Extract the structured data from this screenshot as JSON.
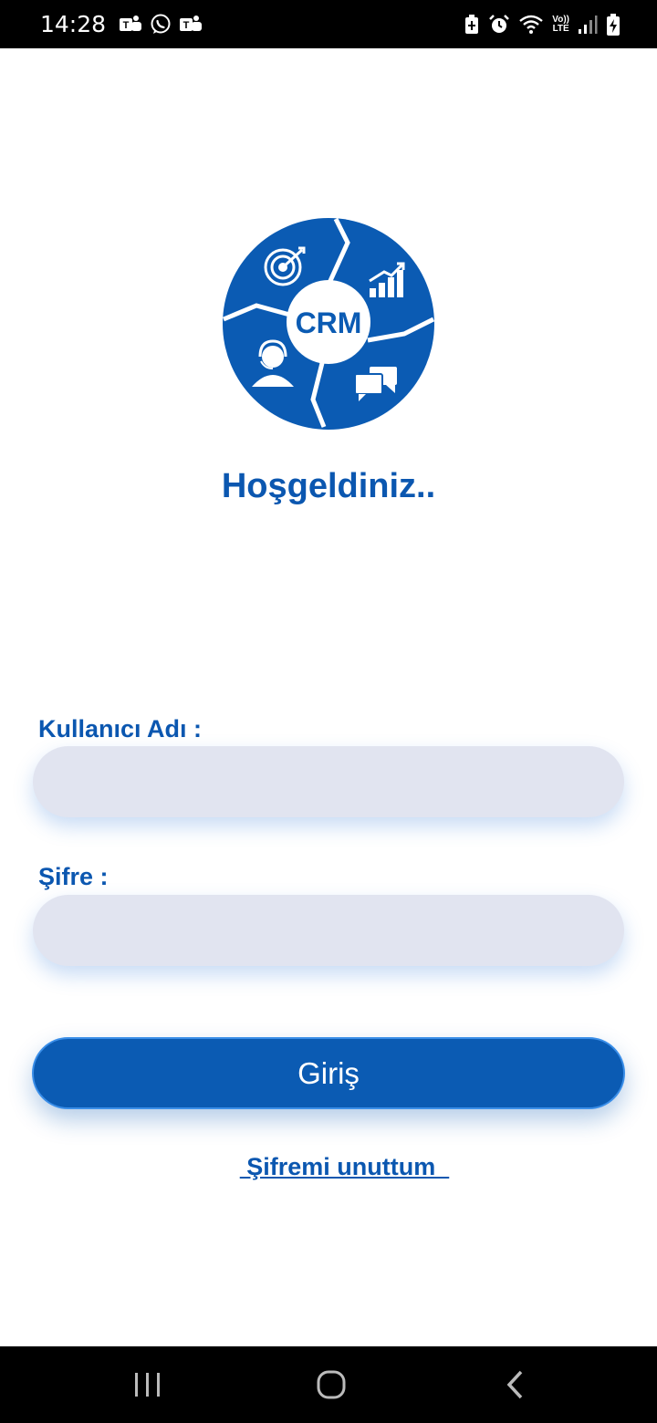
{
  "status_bar": {
    "time": "14:28",
    "left_icons": [
      "teams-icon",
      "whatsapp-icon",
      "teams-icon"
    ],
    "right_icons": [
      "battery-saver-icon",
      "alarm-icon",
      "wifi-icon",
      "volte-icon",
      "signal-icon",
      "battery-charging-icon"
    ],
    "volte_top": "Vo))",
    "volte_bottom": "LTE"
  },
  "logo": {
    "text": "CRM",
    "color": "#0b5bb3"
  },
  "welcome": "Hoşgeldiniz..",
  "form": {
    "username_label": "Kullanıcı Adı :",
    "username_value": "",
    "password_label": "Şifre :",
    "password_value": "",
    "login_label": "Giriş",
    "forgot_label": " Şifremi unuttum  "
  },
  "nav_bar": {
    "icons": [
      "recent-apps-icon",
      "home-icon",
      "back-icon"
    ]
  },
  "colors": {
    "accent": "#0b57b0",
    "button": "#0b5bb3",
    "input_bg": "#e1e4f0"
  }
}
